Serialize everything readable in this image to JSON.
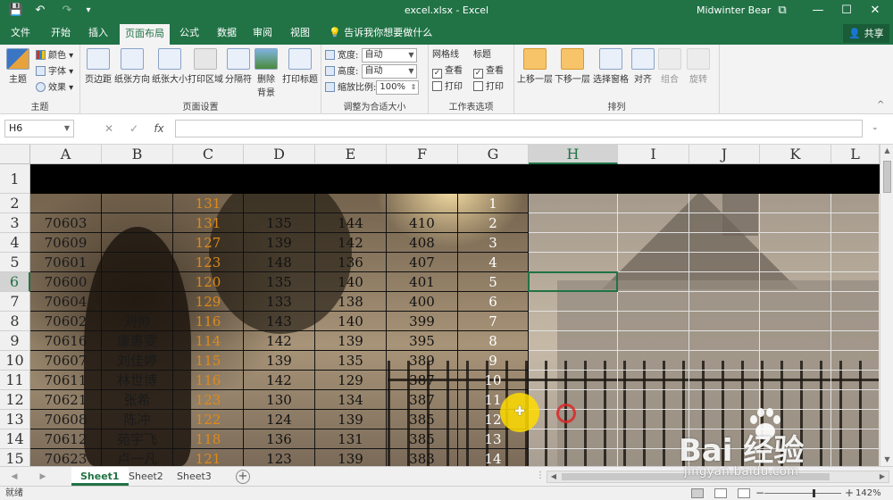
{
  "titlebar": {
    "doc_title": "excel.xlsx  -  Excel",
    "user": "Midwinter Bear",
    "save_glyph": "💾",
    "undo_glyph": "↶",
    "redo_glyph": "↷",
    "customize_glyph": "▾",
    "restore_glyph": "⧉",
    "minimize_glyph": "—",
    "maximize_glyph": "☐",
    "close_glyph": "✕"
  },
  "tabs": {
    "items": [
      "文件",
      "开始",
      "插入",
      "页面布局",
      "公式",
      "数据",
      "审阅",
      "视图"
    ],
    "active": "页面布局",
    "tell_me": "告诉我你想要做什么",
    "share": "共享"
  },
  "ribbon": {
    "theme_group": {
      "label": "主题",
      "theme_button": "主题",
      "colors": "颜色",
      "fonts": "字体",
      "effects": "效果"
    },
    "page_setup_group": {
      "label": "页面设置",
      "buttons": [
        "页边距",
        "纸张方向",
        "纸张大小",
        "打印区域",
        "分隔符",
        "背景",
        "打印标题"
      ],
      "background_sub": "删除"
    },
    "scale_group": {
      "label": "调整为合适大小",
      "width_label": "宽度:",
      "width_value": "自动",
      "height_label": "高度:",
      "height_value": "自动",
      "scale_label": "缩放比例:",
      "scale_value": "100%"
    },
    "sheet_options_group": {
      "label": "工作表选项",
      "gridlines": "网格线",
      "headings": "标题",
      "view": "查看",
      "print": "打印"
    },
    "arrange_group": {
      "label": "排列",
      "buttons": [
        "上移一层",
        "下移一层",
        "选择窗格",
        "对齐",
        "组合",
        "旋转"
      ]
    }
  },
  "formula_bar": {
    "name_box": "H6",
    "cancel_glyph": "✕",
    "enter_glyph": "✓",
    "fx_glyph": "fx",
    "formula": ""
  },
  "grid": {
    "columns": [
      "A",
      "B",
      "C",
      "D",
      "E",
      "F",
      "G",
      "H",
      "I",
      "J",
      "K",
      "L"
    ],
    "selected_column": "H",
    "rows": [
      "1",
      "2",
      "3",
      "4",
      "5",
      "6",
      "7",
      "8",
      "9",
      "10",
      "11",
      "12",
      "13",
      "14",
      "15"
    ],
    "selected_row": "6",
    "data": [
      [
        "",
        "",
        "131",
        "",
        "",
        "",
        "1"
      ],
      [
        "70603",
        "",
        "131",
        "135",
        "144",
        "410",
        "2"
      ],
      [
        "70609",
        "",
        "127",
        "139",
        "142",
        "408",
        "3"
      ],
      [
        "70601",
        "",
        "123",
        "148",
        "136",
        "407",
        "4"
      ],
      [
        "70600",
        "",
        "120",
        "135",
        "140",
        "401",
        "5"
      ],
      [
        "70604",
        "",
        "129",
        "133",
        "138",
        "400",
        "6"
      ],
      [
        "70602",
        "刘帅",
        "116",
        "143",
        "140",
        "399",
        "7"
      ],
      [
        "70616",
        "康惠雯",
        "114",
        "142",
        "139",
        "395",
        "8"
      ],
      [
        "70607",
        "刘佳婷",
        "115",
        "139",
        "135",
        "389",
        "9"
      ],
      [
        "70611",
        "林世博",
        "116",
        "142",
        "129",
        "387",
        "10"
      ],
      [
        "70621",
        "张希",
        "123",
        "130",
        "134",
        "387",
        "11"
      ],
      [
        "70608",
        "陈冲",
        "122",
        "124",
        "139",
        "385",
        "12"
      ],
      [
        "70612",
        "苑宇飞",
        "118",
        "136",
        "131",
        "385",
        "13"
      ],
      [
        "70623",
        "卢一凡",
        "121",
        "123",
        "139",
        "383",
        "14"
      ]
    ]
  },
  "sheets": {
    "items": [
      "Sheet1",
      "Sheet2",
      "Sheet3"
    ],
    "active": "Sheet1",
    "add_glyph": "+"
  },
  "status": {
    "ready": "就绪",
    "zoom_out": "−",
    "zoom_in": "+",
    "zoom": "142%",
    "zoom_level_fraction": 0.63
  },
  "watermark": {
    "text": "Bai  经验",
    "sub": "jingyan.baidu.com"
  }
}
